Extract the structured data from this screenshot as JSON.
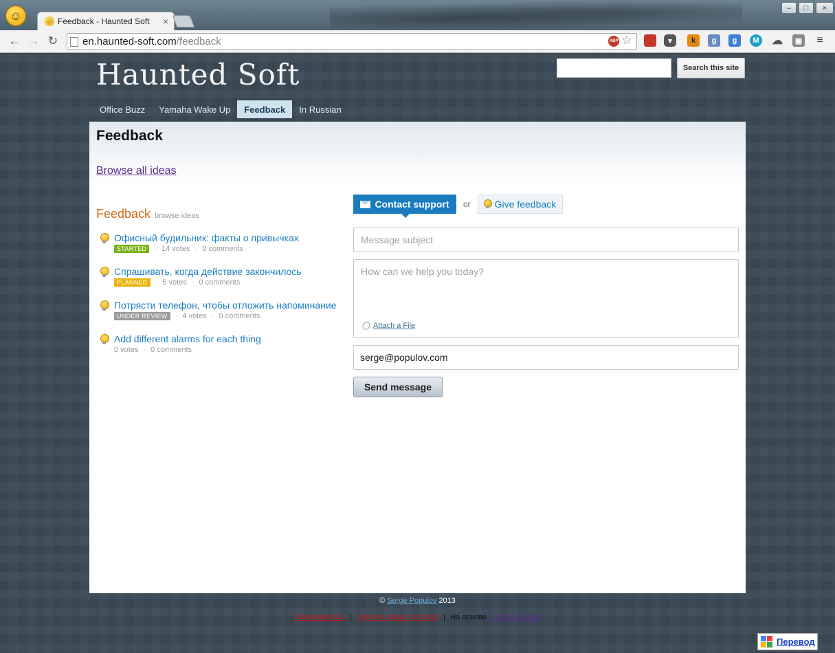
{
  "browser": {
    "tab_title": "Feedback - Haunted Soft",
    "close_glyph": "×",
    "url_host": "en.haunted-soft.com",
    "url_path": "/feedback",
    "window_controls": [
      "–",
      "□",
      "×"
    ],
    "extensions": [
      "adblock-icon",
      "bookmark-red-icon",
      "pocket-icon",
      "k-icon",
      "g-icon",
      "google-plus-icon",
      "m-icon",
      "cloud-icon",
      "gift-icon"
    ]
  },
  "site": {
    "logo": "Haunted Soft",
    "search_button": "Search this site",
    "search_value": ""
  },
  "nav": {
    "items": [
      "Office Buzz",
      "Yamaha Wake Up",
      "Feedback",
      "In Russian"
    ],
    "active": "Feedback"
  },
  "page": {
    "title": "Feedback",
    "browse_all": "Browse all ideas"
  },
  "feedback_widget": {
    "title": "Feedback",
    "subtitle": "browse ideas",
    "ideas": [
      {
        "title": "Офисный будильник: факты о привычках",
        "status": "STARTED",
        "votes": "14 votes",
        "comments": "0 comments"
      },
      {
        "title": "Спрашивать, когда действие закончилось",
        "status": "PLANNED",
        "votes": "5 votes",
        "comments": "0 comments"
      },
      {
        "title": "Потрясти телефон, чтобы отложить напоминание",
        "status": "UNDER REVIEW",
        "votes": "4 votes",
        "comments": "0 comments"
      },
      {
        "title": "Add different alarms for each thing",
        "status": "",
        "votes": "0 votes",
        "comments": "0 comments"
      }
    ]
  },
  "contact": {
    "tab_contact": "Contact support",
    "or": "or",
    "tab_give": "Give feedback",
    "subject_placeholder": "Message subject",
    "message_placeholder": "How can we help you today?",
    "attach": "Attach a File",
    "email_value": "serge@populov.com",
    "send": "Send message"
  },
  "footer": {
    "copy_prefix": "©",
    "author": "Serge Populov",
    "year": "2013",
    "report": "Пожаловаться",
    "revoke": "Удалить право доступа",
    "based_on": "На основе",
    "google_sites": "Сайтов Google",
    "sep": "|"
  },
  "translate": {
    "label": "Перевод"
  }
}
